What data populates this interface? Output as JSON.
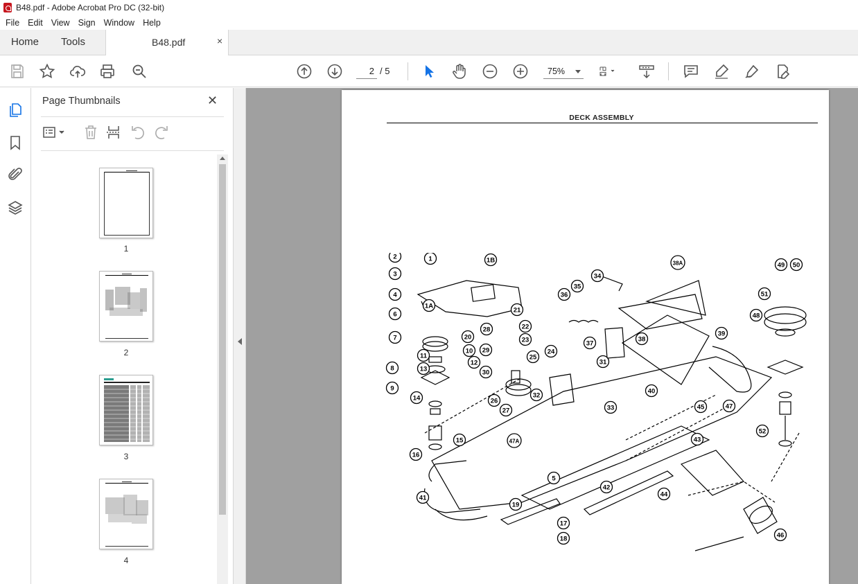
{
  "window": {
    "title": "B48.pdf - Adobe Acrobat Pro DC (32-bit)"
  },
  "menu": {
    "file": "File",
    "edit": "Edit",
    "view": "View",
    "sign": "Sign",
    "window": "Window",
    "help": "Help"
  },
  "tabs": {
    "home": "Home",
    "tools": "Tools",
    "document": "B48.pdf",
    "close": "×"
  },
  "toolbar": {
    "page_current": "2",
    "page_total": "/ 5",
    "zoom": "75%",
    "icons": [
      "save-icon",
      "bookmark-star-icon",
      "upload-icon",
      "print-icon",
      "search-zoom-icon",
      "prev-page-icon",
      "next-page-icon",
      "select-cursor-icon",
      "hand-tool-icon",
      "zoom-out-icon",
      "zoom-in-icon",
      "page-layout-icon",
      "scroll-mode-icon",
      "comment-icon",
      "highlight-icon",
      "draw-icon",
      "fill-sign-icon"
    ]
  },
  "left_rail": {
    "icons": [
      "page-thumbnails-icon",
      "bookmarks-icon",
      "attachments-icon",
      "layers-icon"
    ]
  },
  "panel": {
    "title": "Page Thumbnails",
    "close": "✕",
    "thumbnails": [
      {
        "label": "1"
      },
      {
        "label": "2"
      },
      {
        "label": "3"
      },
      {
        "label": "4"
      }
    ]
  },
  "page": {
    "heading": "DECK ASSEMBLY",
    "callouts": [
      "1",
      "1A",
      "1B",
      "2",
      "3",
      "4",
      "5",
      "6",
      "7",
      "8",
      "9",
      "10",
      "11",
      "12",
      "13",
      "14",
      "15",
      "16",
      "17",
      "18",
      "19",
      "20",
      "21",
      "22",
      "23",
      "24",
      "25",
      "26",
      "27",
      "28",
      "29",
      "30",
      "31",
      "32",
      "33",
      "34",
      "35",
      "36",
      "37",
      "38",
      "38A",
      "39",
      "40",
      "41",
      "42",
      "43",
      "44",
      "45",
      "46",
      "47",
      "47A",
      "48",
      "49",
      "50",
      "51",
      "52"
    ]
  },
  "colors": {
    "doc_background": "#a0a0a0",
    "acrobat_red": "#c7161e",
    "toolbar_icon": "#555555"
  }
}
